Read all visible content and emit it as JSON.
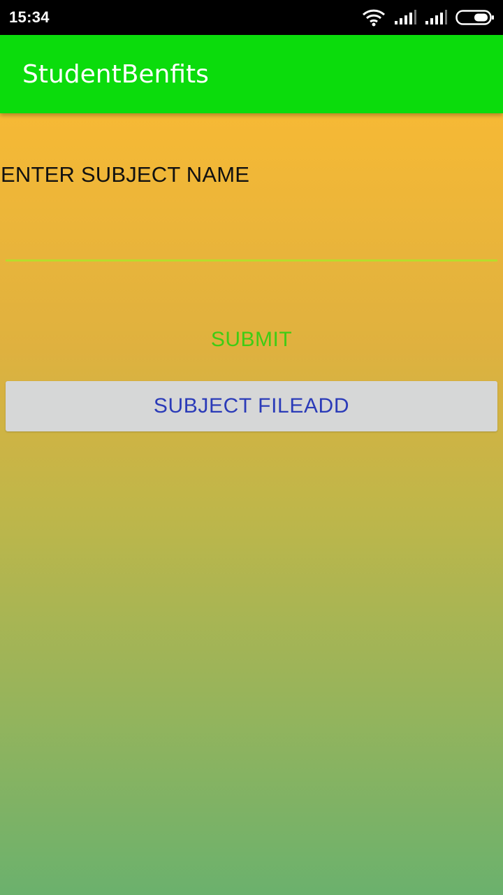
{
  "status_bar": {
    "time": "15:34",
    "icons": [
      "wifi-icon",
      "signal-icon",
      "signal-icon",
      "battery-icon"
    ]
  },
  "app_bar": {
    "title": "StudentBenfits",
    "color": "#0bdc0c"
  },
  "form": {
    "label": "ENTER SUBJECT NAME",
    "input_value": "",
    "submit_label": "SUBMIT",
    "fileadd_label": "SUBJECT FILEADD"
  },
  "colors": {
    "submit_text": "#3fcc14",
    "fileadd_text": "#2b3bb8",
    "input_underline": "#b7dd2c",
    "gradient_top": "#f6b935",
    "gradient_bottom": "#6bb16d"
  }
}
